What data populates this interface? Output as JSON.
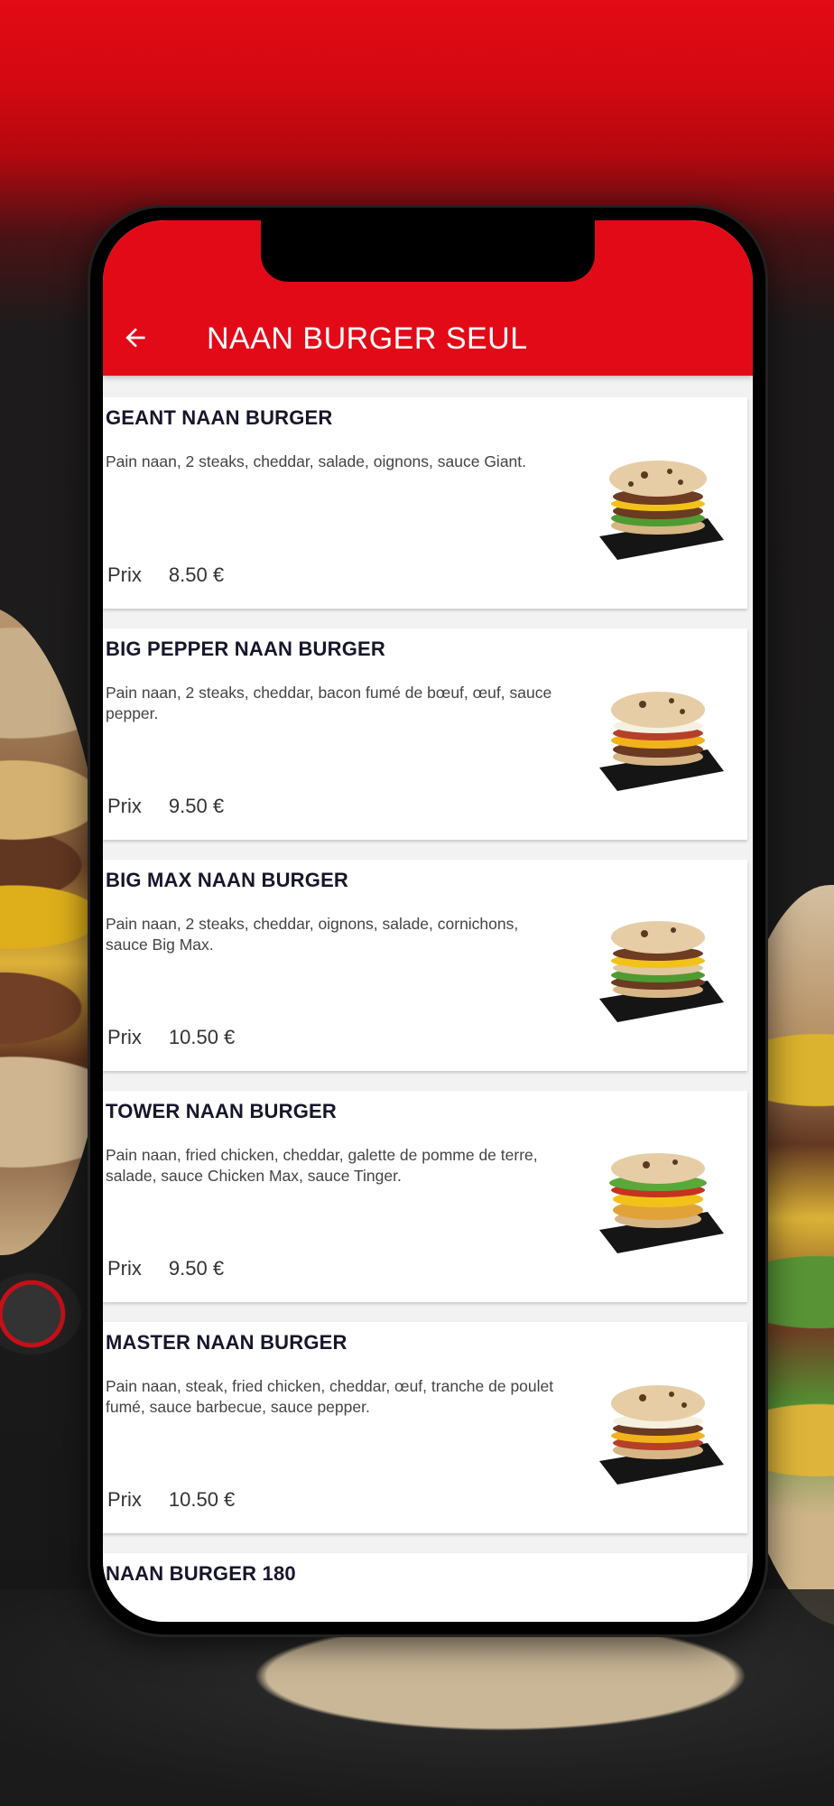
{
  "header": {
    "title": "NAAN BURGER SEUL",
    "back_icon": "arrow-left-icon"
  },
  "colors": {
    "brand_red": "#e30a17",
    "name_text": "#16162c",
    "desc_text": "#444444"
  },
  "price_label": "Prix",
  "items": [
    {
      "name": "GEANT NAAN BURGER",
      "description": "Pain naan, 2 steaks, cheddar, salade, oignons, sauce Giant.",
      "price": "8.50 €"
    },
    {
      "name": "BIG PEPPER NAAN BURGER",
      "description": "Pain naan, 2 steaks, cheddar, bacon fumé de bœuf, œuf, sauce pepper.",
      "price": "9.50 €"
    },
    {
      "name": "BIG MAX NAAN BURGER",
      "description": "Pain naan, 2 steaks, cheddar, oignons, salade, cornichons, sauce Big Max.",
      "price": "10.50 €"
    },
    {
      "name": "TOWER NAAN BURGER",
      "description": "Pain naan, fried chicken, cheddar, galette de pomme de terre, salade, sauce Chicken Max, sauce Tinger.",
      "price": "9.50 €"
    },
    {
      "name": "MASTER NAAN BURGER",
      "description": "Pain naan, steak, fried chicken, cheddar, œuf, tranche de poulet fumé, sauce barbecue, sauce pepper.",
      "price": "10.50 €"
    },
    {
      "name": "NAAN BURGER 180"
    }
  ]
}
